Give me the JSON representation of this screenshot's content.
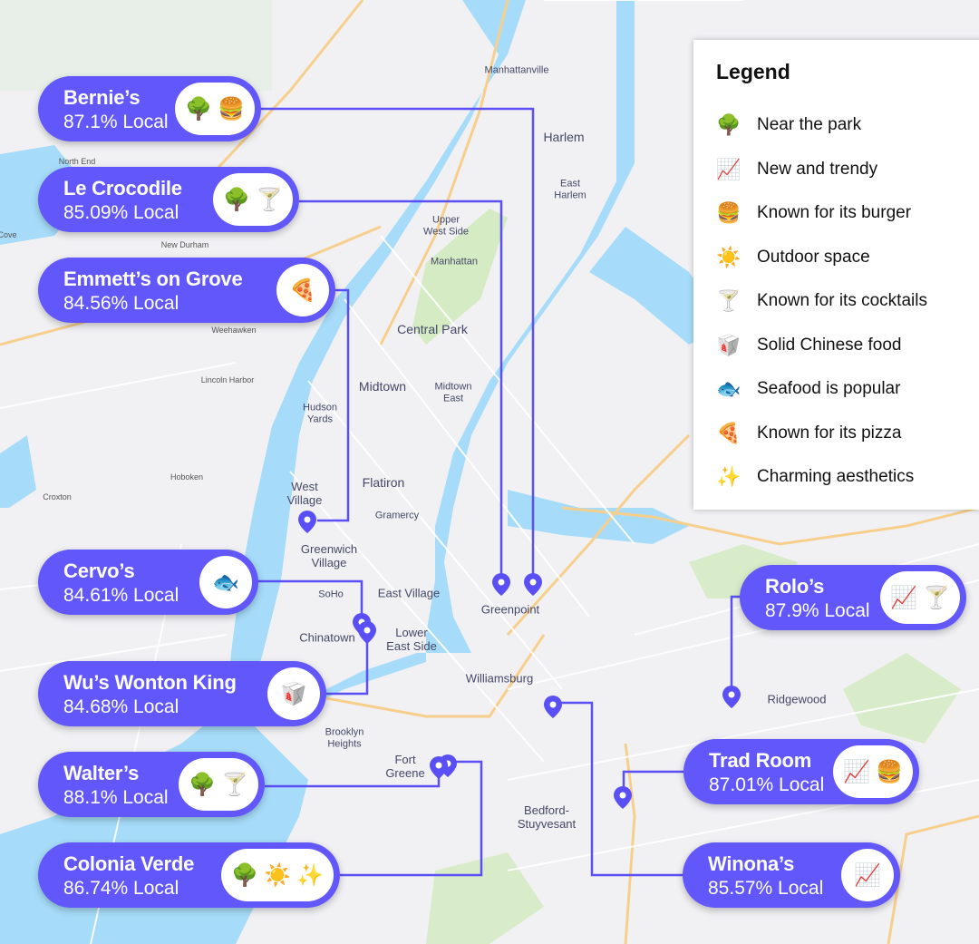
{
  "legend": {
    "title": "Legend",
    "items": [
      {
        "icon": "🌳",
        "icon_name": "tree-icon",
        "label": "Near the park"
      },
      {
        "icon": "📈",
        "icon_name": "chart-trending-up-icon",
        "label": "New and trendy"
      },
      {
        "icon": "🍔",
        "icon_name": "burger-icon",
        "label": "Known for its burger"
      },
      {
        "icon": "☀️",
        "icon_name": "sun-icon",
        "label": "Outdoor space"
      },
      {
        "icon": "🍸",
        "icon_name": "cocktail-icon",
        "label": "Known for its cocktails"
      },
      {
        "icon": "🥡",
        "icon_name": "takeout-box-icon",
        "label": "Solid Chinese food"
      },
      {
        "icon": "🐟",
        "icon_name": "fish-icon",
        "label": "Seafood is popular"
      },
      {
        "icon": "🍕",
        "icon_name": "pizza-icon",
        "label": "Known for its pizza"
      },
      {
        "icon": "✨",
        "icon_name": "sparkles-icon",
        "label": "Charming aesthetics"
      }
    ]
  },
  "restaurants": [
    {
      "name": "Bernie’s",
      "local": "87.1% Local",
      "icons": [
        "🌳",
        "🍔"
      ]
    },
    {
      "name": "Le Crocodile",
      "local": "85.09% Local",
      "icons": [
        "🌳",
        "🍸"
      ]
    },
    {
      "name": "Emmett’s on Grove",
      "local": "84.56% Local",
      "icons": [
        "🍕"
      ]
    },
    {
      "name": "Cervo’s",
      "local": "84.61% Local",
      "icons": [
        "🐟"
      ]
    },
    {
      "name": "Wu’s Wonton King",
      "local": "84.68% Local",
      "icons": [
        "🥡"
      ]
    },
    {
      "name": "Walter’s",
      "local": "88.1% Local",
      "icons": [
        "🌳",
        "🍸"
      ]
    },
    {
      "name": "Colonia Verde",
      "local": "86.74% Local",
      "icons": [
        "🌳",
        "☀️",
        "✨"
      ]
    },
    {
      "name": "Rolo’s",
      "local": "87.9% Local",
      "icons": [
        "📈",
        "🍸"
      ]
    },
    {
      "name": "Trad Room",
      "local": "87.01% Local",
      "icons": [
        "📈",
        "🍔"
      ]
    },
    {
      "name": "Winona’s",
      "local": "85.57% Local",
      "icons": [
        "📈"
      ]
    }
  ],
  "places": {
    "manhattanville": "Manhattanville",
    "harlem": "Harlem",
    "east_harlem": "East\nHarlem",
    "upper_west_side": "Upper\nWest Side",
    "manhattan": "Manhattan",
    "central_park": "Central Park",
    "midtown": "Midtown",
    "midtown_east": "Midtown\nEast",
    "hudson_yards": "Hudson\nYards",
    "west_village": "West\nVillage",
    "flatiron": "Flatiron",
    "gramercy": "Gramercy",
    "greenwich_village": "Greenwich\nVillage",
    "soho": "SoHo",
    "east_village": "East Village",
    "greenpoint": "Greenpoint",
    "chinatown": "Chinatown",
    "lower_east_side": "Lower\nEast Side",
    "williamsburg": "Williamsburg",
    "ridgewood": "Ridgewood",
    "brooklyn_heights": "Brooklyn\nHeights",
    "fort_greene": "Fort\nGreene",
    "bedford_stuyvesant": "Bedford-\nStuyvesant",
    "north_end": "North End",
    "new_durham": "New Durham",
    "weehawken": "Weehawken",
    "lincoln_harbor": "Lincoln Harbor",
    "hoboken": "Hoboken",
    "croxton": "Croxton",
    "cove": "Cove"
  }
}
